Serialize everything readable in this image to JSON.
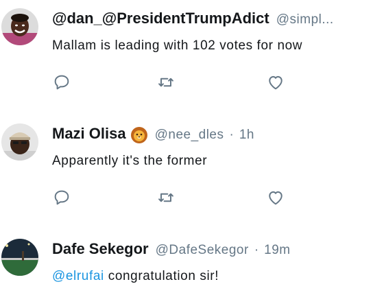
{
  "tweets": [
    {
      "name": "@dan_@PresidentTrumpAdict",
      "handle": "@simpl...",
      "text": "Mallam is leading with 102 votes for now",
      "avatar_icon": "avatar-smiling-boy-photo"
    },
    {
      "name": "Mazi Olisa",
      "emoji_icon": "lion-face-emoji",
      "handle": "@nee_dles",
      "separator": "·",
      "time": "1h",
      "text": "Apparently it's the former",
      "avatar_icon": "avatar-man-cap-photo"
    },
    {
      "name": "Dafe Sekegor",
      "handle": "@DafeSekegor",
      "separator": "·",
      "time": "19m",
      "mention": "@elrufai",
      "text": " congratulation sir!",
      "avatar_icon": "avatar-man-field-photo"
    }
  ],
  "action_icons": [
    "reply-icon",
    "retweet-icon",
    "like-icon"
  ],
  "colors": {
    "icon": "#657786",
    "mention": "#1b95e0",
    "text": "#14171a",
    "muted": "#657786"
  }
}
